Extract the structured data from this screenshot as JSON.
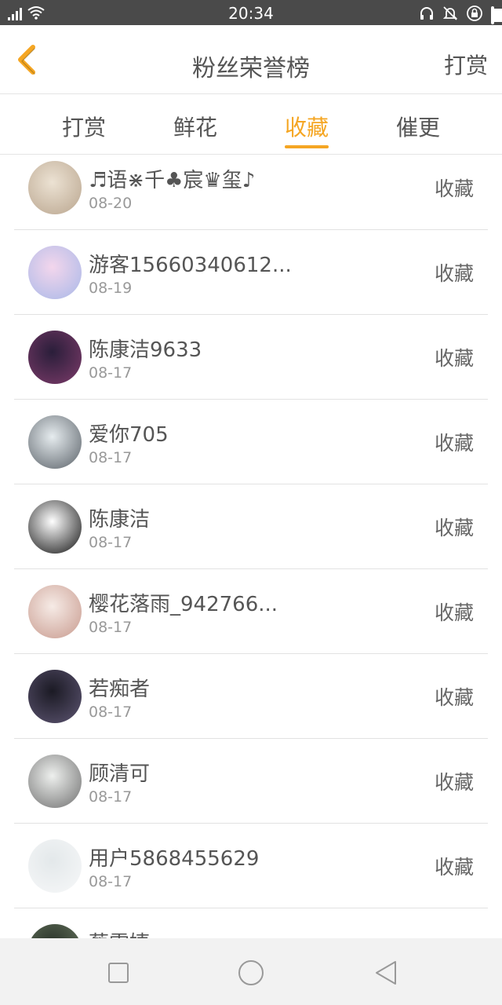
{
  "status_bar": {
    "time": "20:34",
    "icons": [
      "signal-icon",
      "wifi-icon",
      "headphones-icon",
      "bell-off-icon",
      "lock-rotation-icon",
      "battery-icon"
    ],
    "battery_level": 0.45
  },
  "header": {
    "title": "粉丝荣誉榜",
    "action_label": "打赏",
    "back_icon": "chevron-left-icon",
    "accent_color": "#f5a623"
  },
  "tabs": [
    {
      "label": "打赏",
      "active": false
    },
    {
      "label": "鲜花",
      "active": false
    },
    {
      "label": "收藏",
      "active": true
    },
    {
      "label": "催更",
      "active": false
    }
  ],
  "list": [
    {
      "name": "♬语⋇千♣宸♛玺♪",
      "date": "08-20",
      "action": "收藏",
      "avatar_colors": [
        "#ece2d3",
        "#b9a58e"
      ]
    },
    {
      "name": "游客15660340612...",
      "date": "08-19",
      "action": "收藏",
      "avatar_colors": [
        "#f3d6ec",
        "#a8b8e8"
      ]
    },
    {
      "name": "陈康洁9633",
      "date": "08-17",
      "action": "收藏",
      "avatar_colors": [
        "#2a1e3a",
        "#7d3b6a"
      ]
    },
    {
      "name": "爱你705",
      "date": "08-17",
      "action": "收藏",
      "avatar_colors": [
        "#e6ecef",
        "#5a6168"
      ]
    },
    {
      "name": "陈康洁",
      "date": "08-17",
      "action": "收藏",
      "avatar_colors": [
        "#ffffff",
        "#111111"
      ]
    },
    {
      "name": "樱花落雨_942766...",
      "date": "08-17",
      "action": "收藏",
      "avatar_colors": [
        "#f6ebe6",
        "#c89a8e"
      ]
    },
    {
      "name": "若痴者",
      "date": "08-17",
      "action": "收藏",
      "avatar_colors": [
        "#1b1a24",
        "#5d5572"
      ]
    },
    {
      "name": "顾清可",
      "date": "08-17",
      "action": "收藏",
      "avatar_colors": [
        "#eef0ee",
        "#6f6f6f"
      ]
    },
    {
      "name": "用户5868455629",
      "date": "08-17",
      "action": "收藏",
      "avatar_colors": [
        "#e3e8ea",
        "#f7f8f9"
      ]
    },
    {
      "name": "蔡雷婕",
      "date": "",
      "action": "",
      "avatar_colors": [
        "#283128",
        "#6b7a62"
      ]
    }
  ],
  "nav_bar": {
    "buttons": [
      "recent-apps-icon",
      "home-icon",
      "back-icon"
    ]
  }
}
